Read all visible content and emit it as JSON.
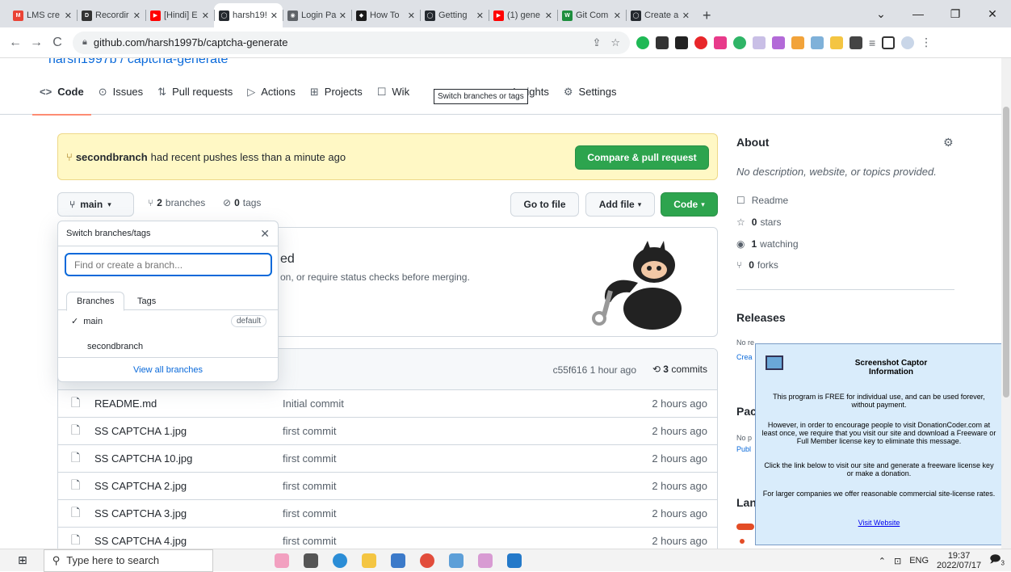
{
  "browser": {
    "tabs": [
      {
        "label": "LMS cre",
        "color": "#ea4335",
        "glyph": "M"
      },
      {
        "label": "Recordir",
        "color": "#333333",
        "glyph": "D"
      },
      {
        "label": "[Hindi] E",
        "color": "#ff0000",
        "glyph": "▶"
      },
      {
        "label": "harsh19!",
        "color": "#24292f",
        "glyph": "◯",
        "active": true
      },
      {
        "label": "Login Pa",
        "color": "#5f6368",
        "glyph": "◉"
      },
      {
        "label": "How To",
        "color": "#1a1a1a",
        "glyph": "◆"
      },
      {
        "label": "Getting",
        "color": "#24292f",
        "glyph": "◯"
      },
      {
        "label": "(1) gene",
        "color": "#ff0000",
        "glyph": "▶"
      },
      {
        "label": "Git Com",
        "color": "#1e8e3e",
        "glyph": "W"
      },
      {
        "label": "Create a",
        "color": "#24292f",
        "glyph": "◯"
      }
    ],
    "new_tab": "+",
    "url": "github.com/harsh1997b/captcha-generate",
    "window_controls": [
      "⌄",
      "—",
      "❐",
      "✕"
    ]
  },
  "repo": {
    "owner_partial": "harsh1997b / captcha-generate",
    "tabs": [
      {
        "icon": "<>",
        "label": "Code",
        "selected": true
      },
      {
        "icon": "⊙",
        "label": "Issues"
      },
      {
        "icon": "⇅",
        "label": "Pull requests"
      },
      {
        "icon": "▷",
        "label": "Actions"
      },
      {
        "icon": "⊞",
        "label": "Projects"
      },
      {
        "icon": "☐",
        "label": "Wik"
      },
      {
        "icon": "",
        "label": "Insights"
      },
      {
        "icon": "⚙",
        "label": "Settings"
      }
    ],
    "tooltip": "Switch branches or tags",
    "banner": {
      "branch": "secondbranch",
      "text": "had recent pushes less than a minute ago",
      "button": "Compare & pull request"
    },
    "branch_button": "main",
    "branches_count": "2",
    "branches_label": "branches",
    "tags_count": "0",
    "tags_label": "tags",
    "go_to_file": "Go to file",
    "add_file": "Add file",
    "code_button": "Code",
    "protect": {
      "heading": "ed",
      "desc": "on, or require status checks before merging."
    },
    "commit_info": {
      "hash": "c55f616",
      "time": "1 hour ago",
      "count": "3",
      "count_label": "commits"
    },
    "files": [
      {
        "name": "README.md",
        "msg": "Initial commit",
        "time": "2 hours ago"
      },
      {
        "name": "SS CAPTCHA 1.jpg",
        "msg": "first commit",
        "time": "2 hours ago"
      },
      {
        "name": "SS CAPTCHA 10.jpg",
        "msg": "first commit",
        "time": "2 hours ago"
      },
      {
        "name": "SS CAPTCHA 2.jpg",
        "msg": "first commit",
        "time": "2 hours ago"
      },
      {
        "name": "SS CAPTCHA 3.jpg",
        "msg": "first commit",
        "time": "2 hours ago"
      },
      {
        "name": "SS CAPTCHA 4.jpg",
        "msg": "first commit",
        "time": "2 hours ago"
      }
    ]
  },
  "dropdown": {
    "title": "Switch branches/tags",
    "placeholder": "Find or create a branch...",
    "tab_branches": "Branches",
    "tab_tags": "Tags",
    "items": [
      {
        "name": "main",
        "badge": "default",
        "checked": true
      },
      {
        "name": "secondbranch"
      }
    ],
    "view_all": "View all branches"
  },
  "about": {
    "title": "About",
    "desc": "No description, website, or topics provided.",
    "readme": "Readme",
    "stars_count": "0",
    "stars_label": "stars",
    "watching_count": "1",
    "watching_label": "watching",
    "forks_count": "0",
    "forks_label": "forks",
    "releases": "Releases",
    "releases_none": "No releases published",
    "releases_create": "Crea",
    "packages": "Pac",
    "packages_none": "No p",
    "packages_pub": "Publ",
    "languages": "Lan"
  },
  "captor": {
    "title": "Screenshot Captor\nInformation",
    "p1": "This program is FREE for individual use, and can be used forever, without payment.",
    "p2": "However, in order to encourage people to visit DonationCoder.com at least once, we require that you visit our site and download a Freeware or Full Member license key to eliminate this message.",
    "p3": "Click the link below to visit our site and generate a freeware license key or make a donation.",
    "p4": "For larger companies we offer reasonable commercial site-license rates.",
    "link": "Visit Website"
  },
  "taskbar": {
    "search": "Type here to search",
    "lang": "ENG",
    "time": "19:37",
    "date": "2022/07/17",
    "notif": "3"
  }
}
